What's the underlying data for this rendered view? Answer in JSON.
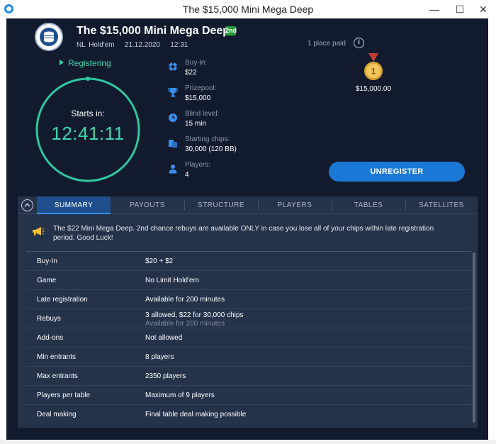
{
  "window": {
    "title": "The $15,000 Mini Mega Deep"
  },
  "header": {
    "title": "The $15,000 Mini Mega Deep",
    "badge": "2nd",
    "game": "NL Hold'em",
    "date": "21.12.2020",
    "time": "12:31"
  },
  "status": {
    "label": "Registering",
    "color": "#3ed6ac"
  },
  "timer": {
    "label": "Starts in:",
    "countdown": "12:41:11"
  },
  "info": [
    {
      "icon": "poker-chip-icon",
      "label": "Buy-in:",
      "value": "$22"
    },
    {
      "icon": "trophy-icon",
      "label": "Prizepool:",
      "value": "$15,000"
    },
    {
      "icon": "clock-icon",
      "label": "Blind level:",
      "value": "15 min"
    },
    {
      "icon": "chips-stack-icon",
      "label": "Starting chips:",
      "value": "30,000 (120 BB)"
    },
    {
      "icon": "player-icon",
      "label": "Players:",
      "value": "4"
    }
  ],
  "prizes": {
    "places_paid": "1 place paid",
    "first_place_medal": "1",
    "first_place_amount": "$15,000.00"
  },
  "actions": {
    "unregister": "UNREGISTER",
    "accent": "#1a78d6"
  },
  "tabs": [
    {
      "label": "SUMMARY",
      "active": true
    },
    {
      "label": "PAYOUTS",
      "active": false
    },
    {
      "label": "STRUCTURE",
      "active": false
    },
    {
      "label": "PLAYERS",
      "active": false
    },
    {
      "label": "TABLES",
      "active": false
    },
    {
      "label": "SATELLITES",
      "active": false
    }
  ],
  "notice": {
    "text": "The $22 Mini Mega Deep. 2nd chance rebuys are available ONLY in case you lose all of your chips within late registration period. Good Luck!"
  },
  "summary": [
    {
      "key": "Buy-In",
      "value": "$20 + $2"
    },
    {
      "key": "Game",
      "value": "No Limit Hold'em"
    },
    {
      "key": "Late registration",
      "value": "Available for 200 minutes"
    },
    {
      "key": "Rebuys",
      "value": "3 allowed, $22 for 30,000 chips",
      "sub": "Available for 200 minutes"
    },
    {
      "key": "Add-ons",
      "value": "Not allowed"
    },
    {
      "key": "Min entrants",
      "value": "8 players"
    },
    {
      "key": "Max entrants",
      "value": "2350 players"
    },
    {
      "key": "Players per table",
      "value": "Maximum of 9 players"
    },
    {
      "key": "Deal making",
      "value": "Final table deal making possible"
    }
  ]
}
